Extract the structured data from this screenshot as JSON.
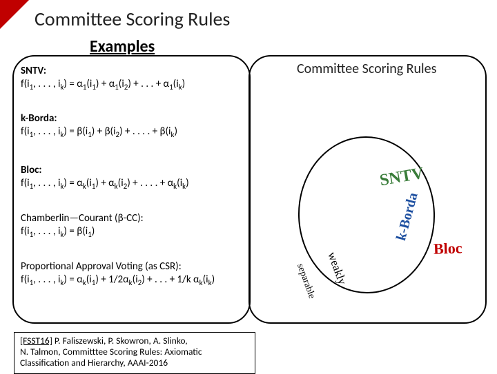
{
  "title": "Committee Scoring Rules",
  "subtitle": "Examples",
  "right_label": "Committee Scoring Rules",
  "examples": {
    "sntv": {
      "name": "SNTV:",
      "formula_html": "f(i<span class='sub'>1</span>, . . . , i<span class='sub'>k</span>) = α<span class='sub'>1</span>(i<span class='sub'>1</span>) + α<span class='sub'>1</span>(i<span class='sub'>2</span>) + . . . + α<span class='sub'>1</span>(i<span class='sub'>k</span>)"
    },
    "kborda": {
      "name": "k-Borda:",
      "formula_html": "f(i<span class='sub'>1</span>, . . . , i<span class='sub'>k</span>) = β(i<span class='sub'>1</span>) + β(i<span class='sub'>2</span>) + . . . . + β(i<span class='sub'>k</span>)"
    },
    "bloc": {
      "name": "Bloc:",
      "formula_html": "f(i<span class='sub'>1</span>, . . . , i<span class='sub'>k</span>) = α<span class='sub'>k</span>(i<span class='sub'>1</span>) + α<span class='sub'>k</span>(i<span class='sub'>2</span>) + . . . . + α<span class='sub'>k</span>(i<span class='sub'>k</span>)"
    },
    "cc": {
      "name_html": "Chamberlin—Courant (β-CC):",
      "formula_html": "f(i<span class='sub'>1</span>, . . . , i<span class='sub'>k</span>) = β(i<span class='sub'>1</span>)"
    },
    "pav": {
      "name_html": "Proportional Approval Voting (as CSR):",
      "formula_html": "f(i<span class='sub'>1</span>, . . . , i<span class='sub'>k</span>) = α<span class='sub'>k</span>(i<span class='sub'>1</span>) + 1/2α<span class='sub'>k</span>(i<span class='sub'>2</span>) + . . . + 1/k α<span class='sub'>k</span>(i<span class='sub'>k</span>)"
    }
  },
  "tags": {
    "sntv": "SNTV",
    "bloc": "Bloc",
    "kborda": "k-Borda",
    "weakly_l1": "weakly",
    "weakly_l2": "separable"
  },
  "citation": {
    "ref": "[FSST16]",
    "rest_html": " P. Faliszewski, P. Skowron, A. Slinko,<br>N. Talmon, Committtee Scoring Rules: Axiomatic<br>Classification and Hierarchy, AAAI-2016"
  }
}
